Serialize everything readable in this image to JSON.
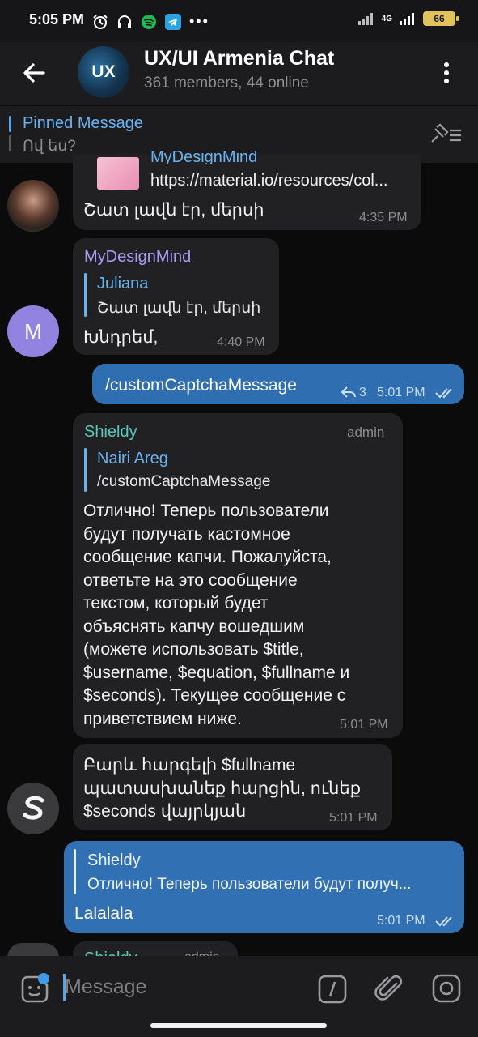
{
  "status_bar": {
    "time": "5:05 PM",
    "network": "4G",
    "battery": "66"
  },
  "header": {
    "avatar_text": "UX",
    "title": "UX/UI Armenia Chat",
    "subtitle": "361 members, 44 online"
  },
  "pinned": {
    "title": "Pinned Message",
    "text": "Ով ես?"
  },
  "messages": {
    "m1": {
      "link_title": "MyDesignMind",
      "link_url": "https://material.io/resources/col...",
      "text": "Շատ լավն էր, մերսի",
      "time": "4:35 PM"
    },
    "m2": {
      "sender": "MyDesignMind",
      "avatar_letter": "M",
      "quote_name": "Juliana",
      "quote_text": "Շատ լավն էր, մերսի",
      "text": "Խնդրեմ,",
      "time": "4:40 PM"
    },
    "m3": {
      "text": "/customCaptchaMessage",
      "replies": "3",
      "time": "5:01 PM"
    },
    "m4": {
      "sender": "Shieldy",
      "role": "admin",
      "quote_name": "Nairi Areg",
      "quote_text": "/customCaptchaMessage",
      "lines": [
        "Отлично! Теперь пользователи",
        "будут получать кастомное",
        "сообщение капчи. Пожалуйста,",
        "ответьте на это сообщение",
        "текстом, который будет",
        "объяснять капчу вошедшим",
        "(можете использовать $title,",
        "$username, $equation, $fullname и",
        "$seconds). Текущее сообщение с",
        "приветствием ниже."
      ],
      "time": "5:01 PM"
    },
    "m5": {
      "lines": [
        "Բարև հարգելի $fullname",
        "պատասխանեք հարցին, ունեք",
        "$seconds վայրկյան"
      ],
      "time": "5:01 PM"
    },
    "m6": {
      "quote_name": "Shieldy",
      "quote_text": "Отлично! Теперь пользователи будут получ...",
      "text": "Lalalala",
      "time": "5:01 PM"
    },
    "m7": {
      "sender": "Shieldy",
      "role": "admin"
    }
  },
  "input": {
    "placeholder": "Message"
  },
  "colors": {
    "accent": "#6ab3f3",
    "outgoing": "#2f6eb0",
    "incoming": "#212123",
    "shieldy": "#58c9b9",
    "mydesignmind": "#a99cf5"
  }
}
